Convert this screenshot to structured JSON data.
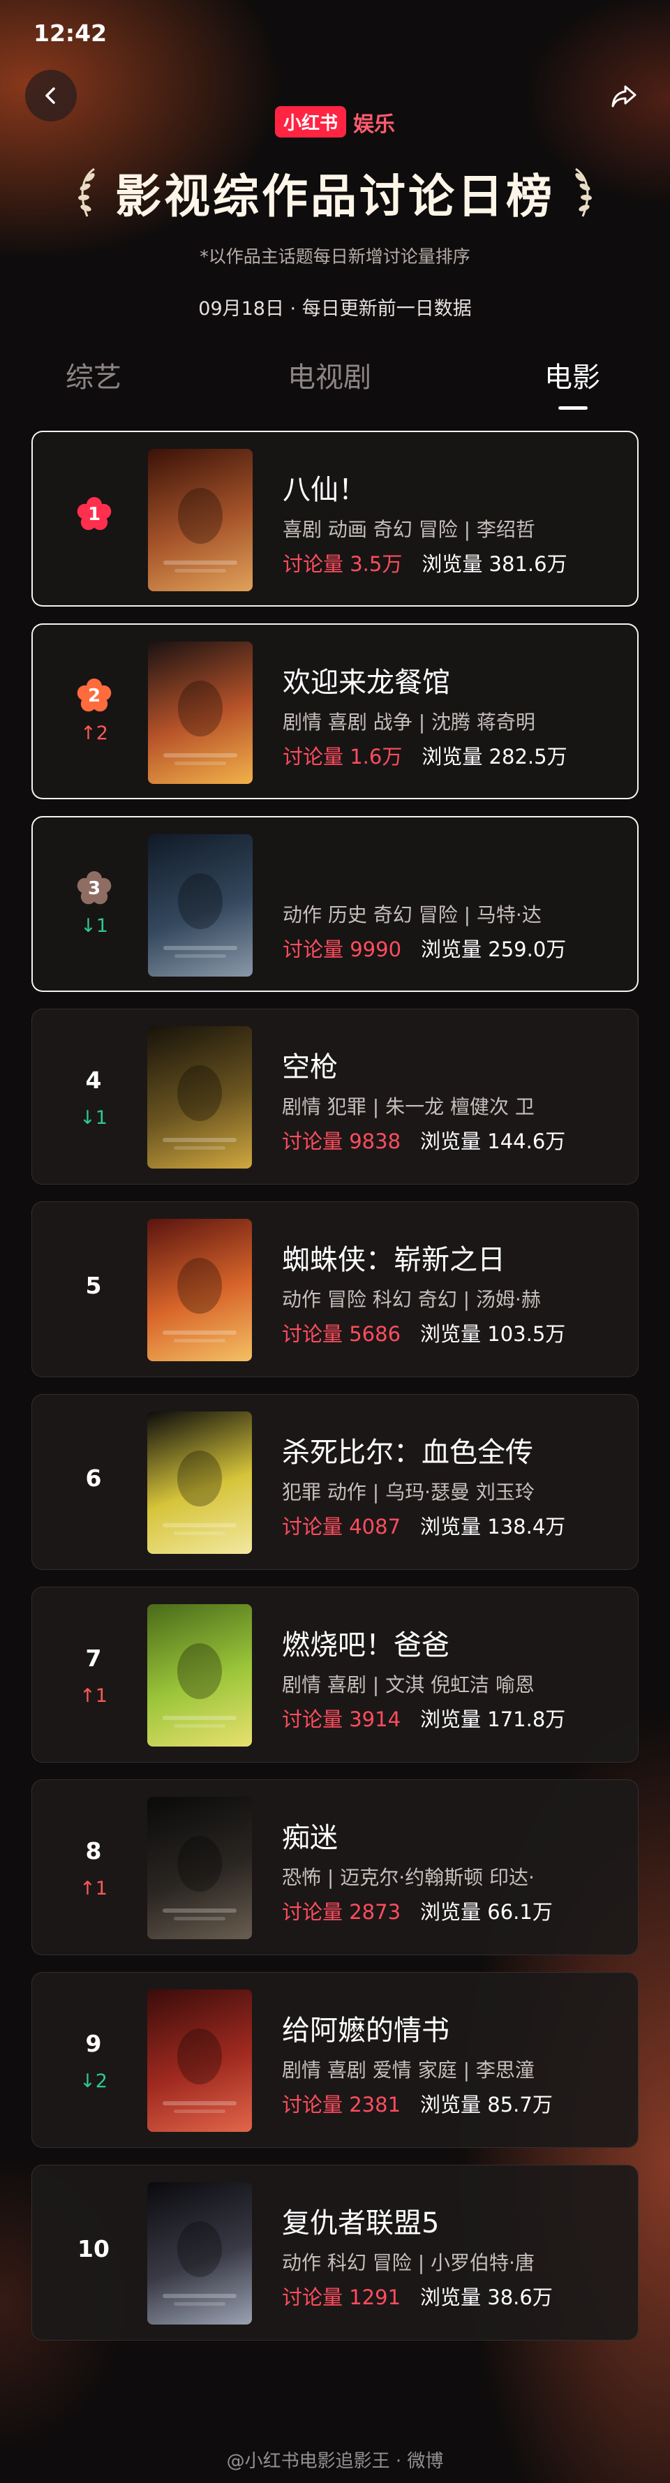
{
  "status_bar": {
    "time": "12:42"
  },
  "brand": {
    "logo": "小红书",
    "suffix": "娱乐"
  },
  "title": "影视综作品讨论日榜",
  "subtitle": "*以作品主话题每日新增讨论量排序",
  "date_line": "09月18日 · 每日更新前一日数据",
  "tabs": [
    {
      "label": "综艺",
      "active": false
    },
    {
      "label": "电视剧",
      "active": false
    },
    {
      "label": "电影",
      "active": true
    }
  ],
  "ranking": [
    {
      "rank": "1",
      "change": "",
      "change_dir": "none",
      "title": "八仙！",
      "tags": "喜剧 动画 奇幻 冒险 | 李绍哲",
      "discussion": "讨论量 3.5万",
      "views": "浏览量 381.6万",
      "flower_color": "#ff2f4e",
      "poster_colors": [
        "#3a1208",
        "#a6542a",
        "#e0a25a"
      ]
    },
    {
      "rank": "2",
      "change": "↑2",
      "change_dir": "up",
      "title": "欢迎来龙餐馆",
      "tags": "剧情 喜剧 战争 | 沈腾 蒋奇明",
      "discussion": "讨论量 1.6万",
      "views": "浏览量 282.5万",
      "flower_color": "#ff6b3d",
      "poster_colors": [
        "#1a1212",
        "#b8542a",
        "#f2b24a"
      ]
    },
    {
      "rank": "3",
      "change": "↓1",
      "change_dir": "down",
      "title": "",
      "tags": "动作 历史 奇幻 冒险 | 马特·达",
      "discussion": "讨论量 9990",
      "views": "浏览量 259.0万",
      "flower_color": "#8f6d63",
      "poster_colors": [
        "#101a26",
        "#34485e",
        "#8a98a8"
      ]
    },
    {
      "rank": "4",
      "change": "↓1",
      "change_dir": "down",
      "title": "空枪",
      "tags": "剧情 犯罪 | 朱一龙 檀健次 卫",
      "discussion": "讨论量 9838",
      "views": "浏览量 144.6万",
      "flower_color": "",
      "poster_colors": [
        "#17130a",
        "#6a5420",
        "#d0a840"
      ]
    },
    {
      "rank": "5",
      "change": "",
      "change_dir": "none",
      "title": "蜘蛛侠：崭新之日",
      "tags": "动作 冒险 科幻 奇幻 | 汤姆·赫",
      "discussion": "讨论量 5686",
      "views": "浏览量 103.5万",
      "flower_color": "",
      "poster_colors": [
        "#5a1410",
        "#d8652a",
        "#f4c064"
      ]
    },
    {
      "rank": "6",
      "change": "",
      "change_dir": "none",
      "title": "杀死比尔：血色全传",
      "tags": "犯罪 动作 | 乌玛·瑟曼 刘玉玲",
      "discussion": "讨论量 4087",
      "views": "浏览量 138.4万",
      "flower_color": "",
      "poster_colors": [
        "#0c0c0c",
        "#d6c43a",
        "#f2e8a0"
      ]
    },
    {
      "rank": "7",
      "change": "↑1",
      "change_dir": "up",
      "title": "燃烧吧！爸爸",
      "tags": "剧情 喜剧 | 文淇 倪虹洁 喻恩",
      "discussion": "讨论量 3914",
      "views": "浏览量 171.8万",
      "flower_color": "",
      "poster_colors": [
        "#4a6a1a",
        "#9cc63a",
        "#e8e070"
      ]
    },
    {
      "rank": "8",
      "change": "↑1",
      "change_dir": "up",
      "title": "痴迷",
      "tags": "恐怖 | 迈克尔·约翰斯顿 印达·",
      "discussion": "讨论量 2873",
      "views": "浏览量 66.1万",
      "flower_color": "",
      "poster_colors": [
        "#0a0a0a",
        "#2a2622",
        "#6a5e50"
      ]
    },
    {
      "rank": "9",
      "change": "↓2",
      "change_dir": "down",
      "title": "给阿嬷的情书",
      "tags": "剧情 喜剧 爱情 家庭 | 李思潼",
      "discussion": "讨论量 2381",
      "views": "浏览量 85.7万",
      "flower_color": "",
      "poster_colors": [
        "#3a0c0a",
        "#a02a20",
        "#e2664a"
      ]
    },
    {
      "rank": "10",
      "change": "",
      "change_dir": "none",
      "title": "复仇者联盟5",
      "tags": "动作 科幻 冒险 | 小罗伯特·唐",
      "discussion": "讨论量 1291",
      "views": "浏览量 38.6万",
      "flower_color": "",
      "poster_colors": [
        "#0a0a0e",
        "#3a3a46",
        "#9aa2b2"
      ]
    }
  ],
  "watermark": "@小红书电影追影王 · 微博"
}
